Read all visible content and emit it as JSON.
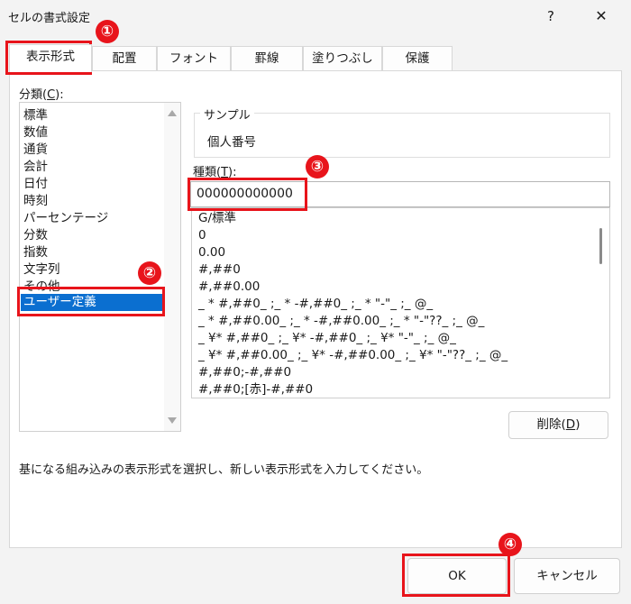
{
  "window": {
    "title": "セルの書式設定",
    "help_label": "?",
    "close_label": "✕"
  },
  "tabs": [
    {
      "label": "表示形式",
      "active": true
    },
    {
      "label": "配置"
    },
    {
      "label": "フォント"
    },
    {
      "label": "罫線"
    },
    {
      "label": "塗りつぶし"
    },
    {
      "label": "保護"
    }
  ],
  "category": {
    "label_prefix": "分類(",
    "label_key": "C",
    "label_suffix": "):",
    "items": [
      "標準",
      "数値",
      "通貨",
      "会計",
      "日付",
      "時刻",
      "パーセンテージ",
      "分数",
      "指数",
      "文字列",
      "その他",
      "ユーザー定義"
    ],
    "selected": "ユーザー定義"
  },
  "sample": {
    "legend": "サンプル",
    "value": "個人番号"
  },
  "type": {
    "label_prefix": "種類(",
    "label_key": "T",
    "label_suffix": "):",
    "value": "000000000000"
  },
  "formats": [
    "G/標準",
    "0",
    "0.00",
    "#,##0",
    "#,##0.00",
    "_ * #,##0_ ;_ * -#,##0_ ;_ * \"-\"_ ;_ @_",
    "_ * #,##0.00_ ;_ * -#,##0.00_ ;_ * \"-\"??_ ;_ @_",
    "_ ¥* #,##0_ ;_ ¥* -#,##0_ ;_ ¥* \"-\"_ ;_ @_",
    "_ ¥* #,##0.00_ ;_ ¥* -#,##0.00_ ;_ ¥* \"-\"??_ ;_ @_",
    "#,##0;-#,##0",
    "#,##0;[赤]-#,##0"
  ],
  "buttons": {
    "delete_prefix": "削除(",
    "delete_key": "D",
    "delete_suffix": ")",
    "ok": "OK",
    "cancel": "キャンセル"
  },
  "description": "基になる組み込みの表示形式を選択し、新しい表示形式を入力してください。",
  "annotations": {
    "color": "#e8141b",
    "steps": [
      "①",
      "②",
      "③",
      "④"
    ]
  }
}
